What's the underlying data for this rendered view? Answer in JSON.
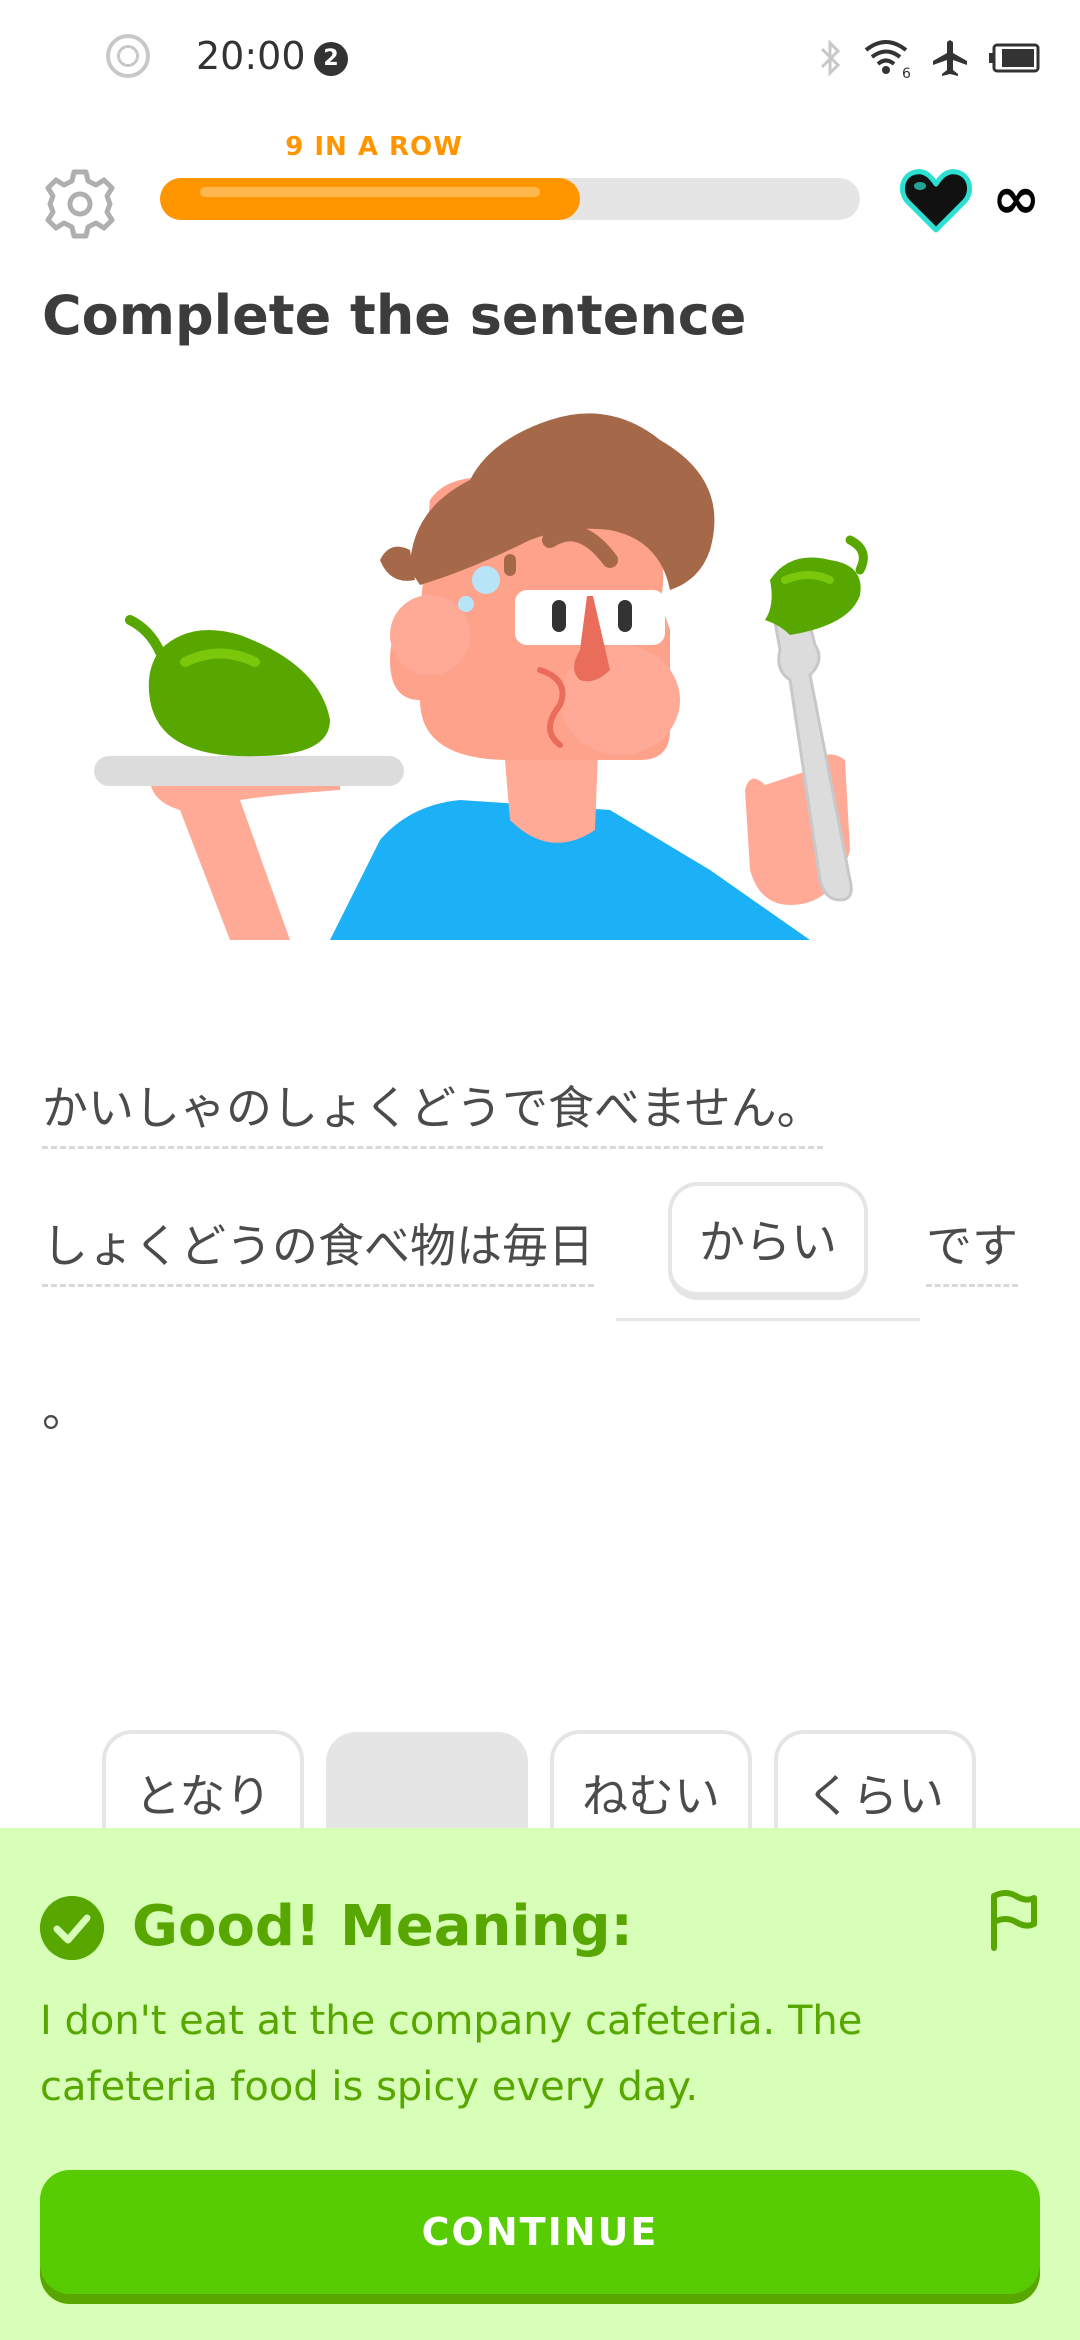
{
  "status_bar": {
    "time": "20:00",
    "notification_count": "2",
    "wifi_badge": "6"
  },
  "header": {
    "streak_label": "9 IN A ROW",
    "progress": 0.6,
    "hearts": "∞"
  },
  "page_title": "Complete the sentence",
  "sentence": {
    "line1": "かいしゃのしょくどうで食べません。",
    "line2_prefix": "しょくどうの食べ物は毎日",
    "selected_answer": "からい",
    "line2_suffix": "です",
    "trailing": "。"
  },
  "word_bank": [
    "となり",
    "",
    "ねむい",
    "くらい"
  ],
  "feedback": {
    "title": "Good! Meaning:",
    "text": "I don't eat at the company cafeteria. The cafeteria food is spicy every day.",
    "continue_label": "CONTINUE"
  },
  "colors": {
    "streak_orange": "#ff9600",
    "success_green": "#58a700",
    "button_green": "#58cc02",
    "feedback_bg": "#d7ffb8",
    "heart_outline": "#2be0d2"
  }
}
